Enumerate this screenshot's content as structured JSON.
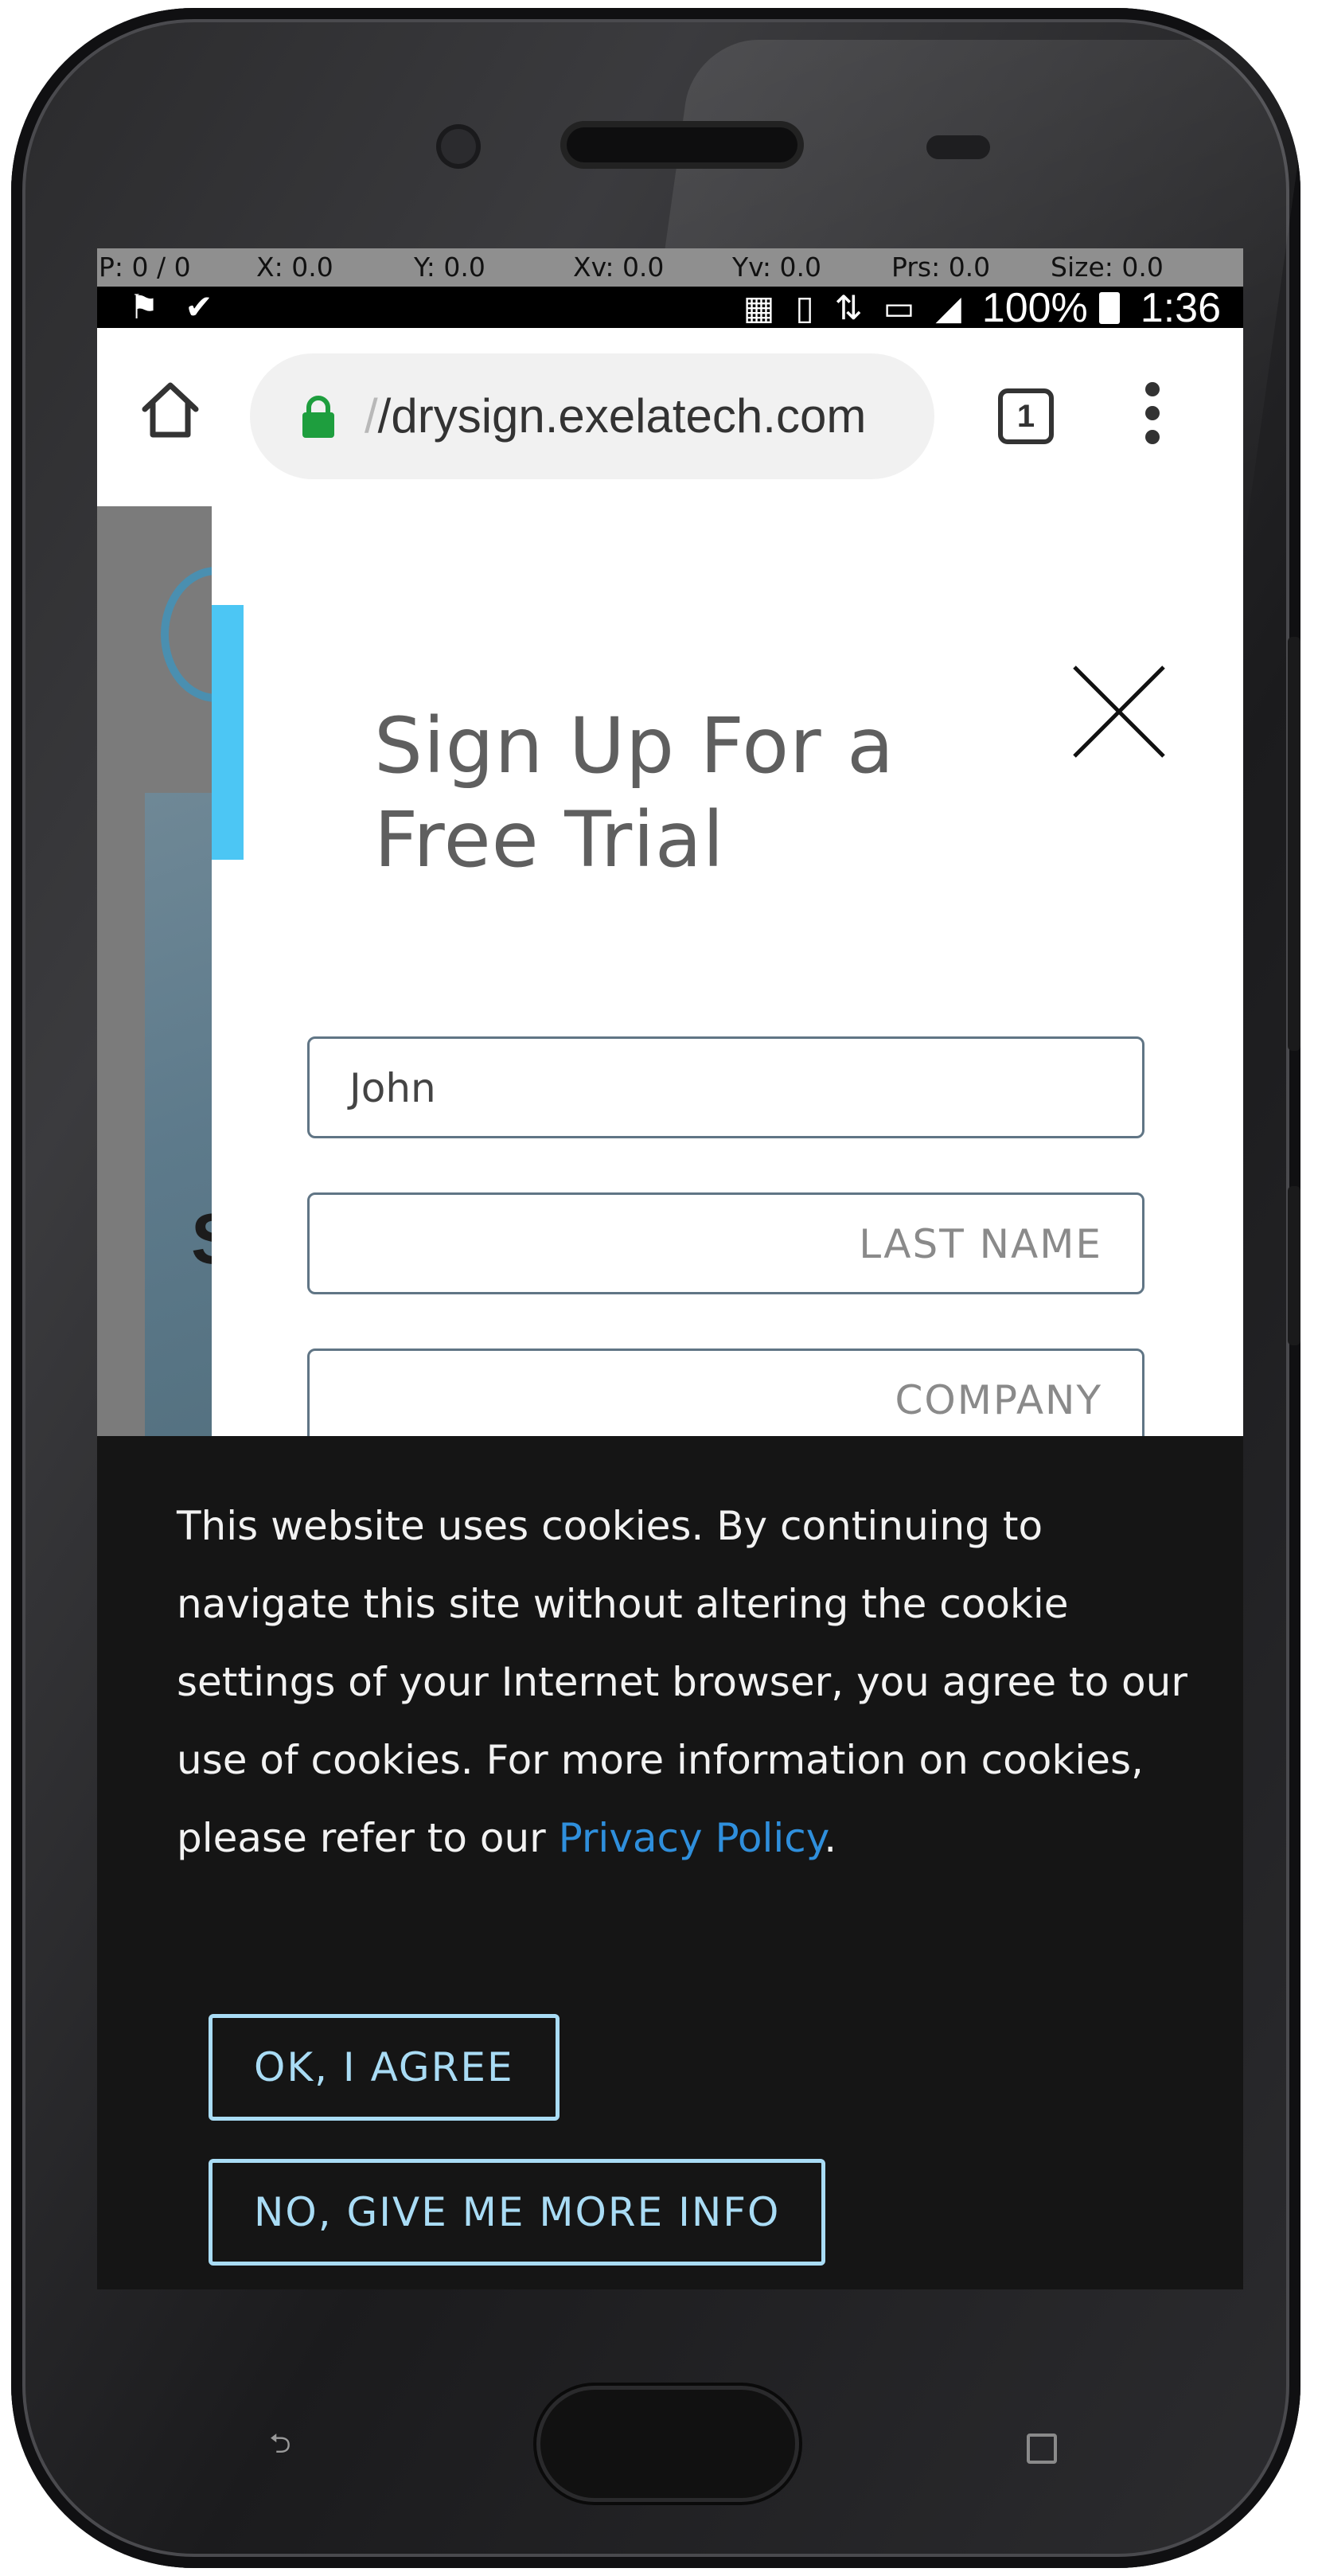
{
  "debug_bar": {
    "p": "P: 0 / 0",
    "x": "X: 0.0",
    "y": "Y: 0.0",
    "xv": "Xv: 0.0",
    "yv": "Yv: 0.0",
    "prs": "Prs: 0.0",
    "size": "Size: 0.0"
  },
  "status_bar": {
    "battery": "100%",
    "time": "1:36",
    "left_icons": [
      "notification-icon",
      "task-check-icon"
    ],
    "right_icons": [
      "nfc-icon",
      "vibrate-icon",
      "wifi-icon",
      "no-sim-icon",
      "no-signal-icon",
      "battery-icon"
    ]
  },
  "browser": {
    "url_prefix": "/",
    "url": "/drysign.exelatech.com",
    "tab_count": "1"
  },
  "modal": {
    "title": "Sign Up For a Free Trial",
    "fields": [
      {
        "value": "John",
        "placeholder": ""
      },
      {
        "value": "",
        "placeholder": "LAST NAME"
      },
      {
        "value": "",
        "placeholder": "COMPANY"
      }
    ]
  },
  "cookie_banner": {
    "text": "This website uses cookies. By continuing to navigate this site without altering the cookie settings of your Internet browser, you agree to our use of cookies. For more information on cookies, please refer to our ",
    "link": "Privacy Policy",
    "text_end": ".",
    "agree_button": "OK, I AGREE",
    "more_info_button": "NO, GIVE ME MORE INFO"
  },
  "hardware": {
    "back_glyph": "⮌"
  },
  "colors": {
    "accent": "#4cc6f4",
    "link": "#2f8fdc",
    "button_outline": "#a9dcf5",
    "cookie_bg": "#151515",
    "secure_lock": "#1e9e3e"
  }
}
